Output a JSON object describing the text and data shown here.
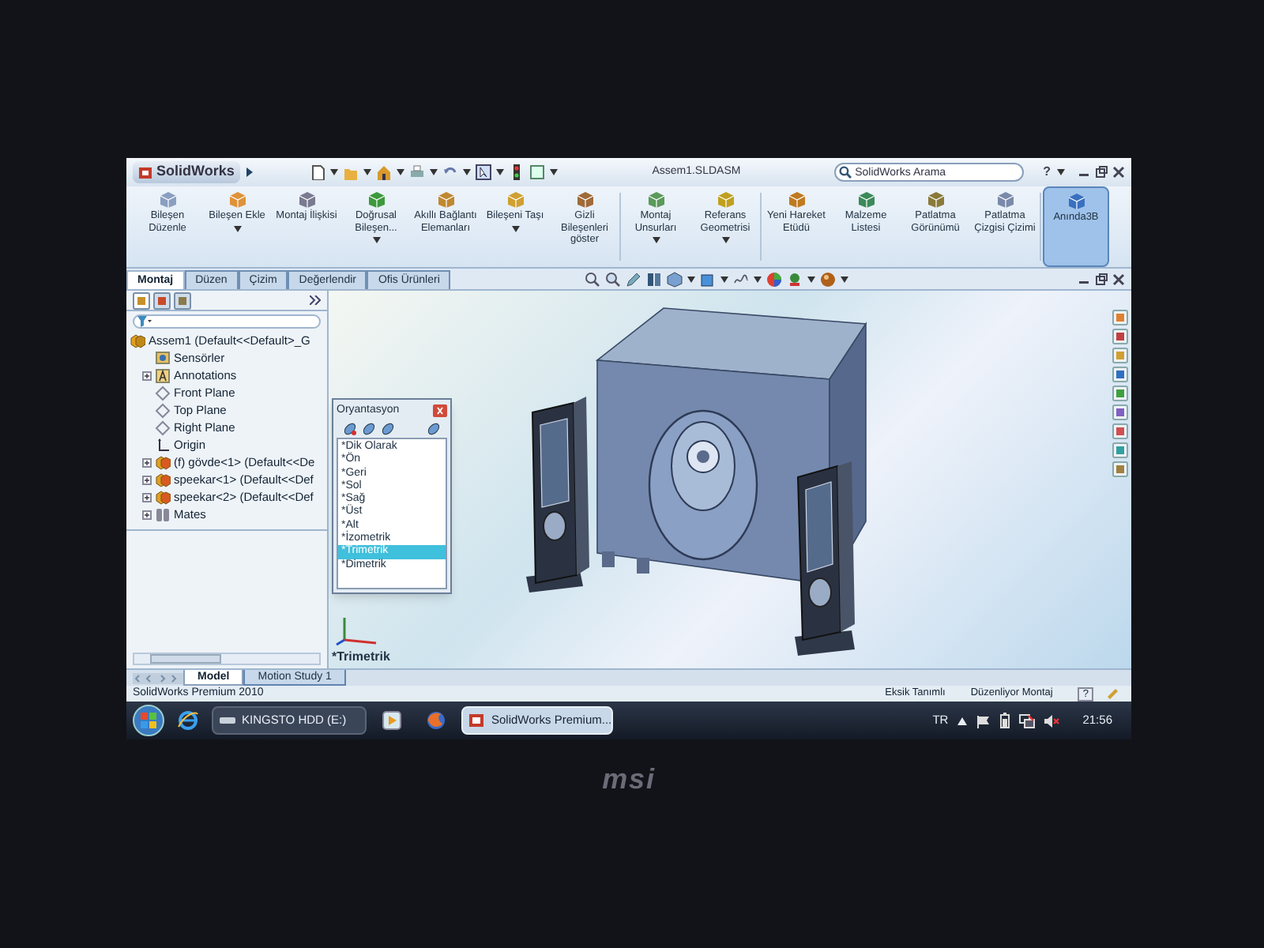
{
  "title_bar": {
    "app_name": "SolidWorks",
    "document_title": "Assem1.SLDASM",
    "search": {
      "placeholder": "SolidWorks Arama"
    },
    "help": "?"
  },
  "ribbon": [
    {
      "label": "Bileşen Düzenle",
      "dropdown": false,
      "selected": false
    },
    {
      "label": "Bileşen Ekle",
      "dropdown": true,
      "selected": false
    },
    {
      "label": "Montaj İlişkisi",
      "dropdown": false,
      "selected": false
    },
    {
      "label": "Doğrusal Bileşen...",
      "dropdown": true,
      "selected": false
    },
    {
      "label": "Akıllı Bağlantı Elemanları",
      "dropdown": false,
      "selected": false
    },
    {
      "label": "Bileşeni Taşı",
      "dropdown": true,
      "selected": false
    },
    {
      "label": "Gizli Bileşenleri göster",
      "dropdown": false,
      "selected": false
    },
    {
      "label": "Montaj Unsurları",
      "dropdown": true,
      "selected": false
    },
    {
      "label": "Referans Geometrisi",
      "dropdown": true,
      "selected": false
    },
    {
      "label": "Yeni Hareket Etüdü",
      "dropdown": false,
      "selected": false
    },
    {
      "label": "Malzeme Listesi",
      "dropdown": false,
      "selected": false
    },
    {
      "label": "Patlatma Görünümü",
      "dropdown": false,
      "selected": false
    },
    {
      "label": "Patlatma Çizgisi Çizimi",
      "dropdown": false,
      "selected": false
    },
    {
      "label": "Anında3B",
      "dropdown": false,
      "selected": true
    }
  ],
  "command_tabs": [
    {
      "label": "Montaj",
      "selected": true
    },
    {
      "label": "Düzen",
      "selected": false
    },
    {
      "label": "Çizim",
      "selected": false
    },
    {
      "label": "Değerlendir",
      "selected": false
    },
    {
      "label": "Ofis Ürünleri",
      "selected": false
    }
  ],
  "feature_tree": {
    "root": {
      "label": "Assem1  (Default<<Default>_G",
      "kind": "assembly",
      "children": [
        {
          "label": "Sensörler",
          "kind": "sensor"
        },
        {
          "label": "Annotations",
          "kind": "annotation",
          "expanded": false
        },
        {
          "label": "Front Plane",
          "kind": "plane"
        },
        {
          "label": "Top Plane",
          "kind": "plane"
        },
        {
          "label": "Right Plane",
          "kind": "plane"
        },
        {
          "label": "Origin",
          "kind": "origin"
        },
        {
          "label": "(f) gövde<1> (Default<<De",
          "kind": "part",
          "expanded": false
        },
        {
          "label": "speekar<1> (Default<<Def",
          "kind": "part",
          "expanded": false
        },
        {
          "label": "speekar<2> (Default<<Def",
          "kind": "part",
          "expanded": false
        },
        {
          "label": "Mates",
          "kind": "mates",
          "expanded": false
        }
      ]
    }
  },
  "orientation_dialog": {
    "title": "Oryantasyon",
    "views": [
      {
        "label": "*Dik Olarak",
        "selected": false
      },
      {
        "label": "*Ön",
        "selected": false
      },
      {
        "label": "*Geri",
        "selected": false
      },
      {
        "label": "*Sol",
        "selected": false
      },
      {
        "label": "*Sağ",
        "selected": false
      },
      {
        "label": "*Üst",
        "selected": false
      },
      {
        "label": "*Alt",
        "selected": false
      },
      {
        "label": "*İzometrik",
        "selected": false
      },
      {
        "label": "*Trimetrik",
        "selected": true
      },
      {
        "label": "*Dimetrik",
        "selected": false
      }
    ]
  },
  "view_label": "*Trimetrik",
  "bottom_tabs": [
    {
      "label": "Model",
      "selected": true
    },
    {
      "label": "Motion Study 1",
      "selected": false
    }
  ],
  "status_bar": {
    "product": "SolidWorks Premium 2010",
    "items": [
      "Eksik Tanımlı",
      "Düzenliyor Montaj"
    ],
    "help": "?"
  },
  "taskbar": {
    "buttons": [
      {
        "label": "KINGSTO HDD (E:)",
        "selected": false
      },
      {
        "label": "SolidWorks Premium...",
        "selected": true
      }
    ],
    "language": "TR",
    "clock": "21:56"
  },
  "bezel": {
    "logo": "msi"
  }
}
